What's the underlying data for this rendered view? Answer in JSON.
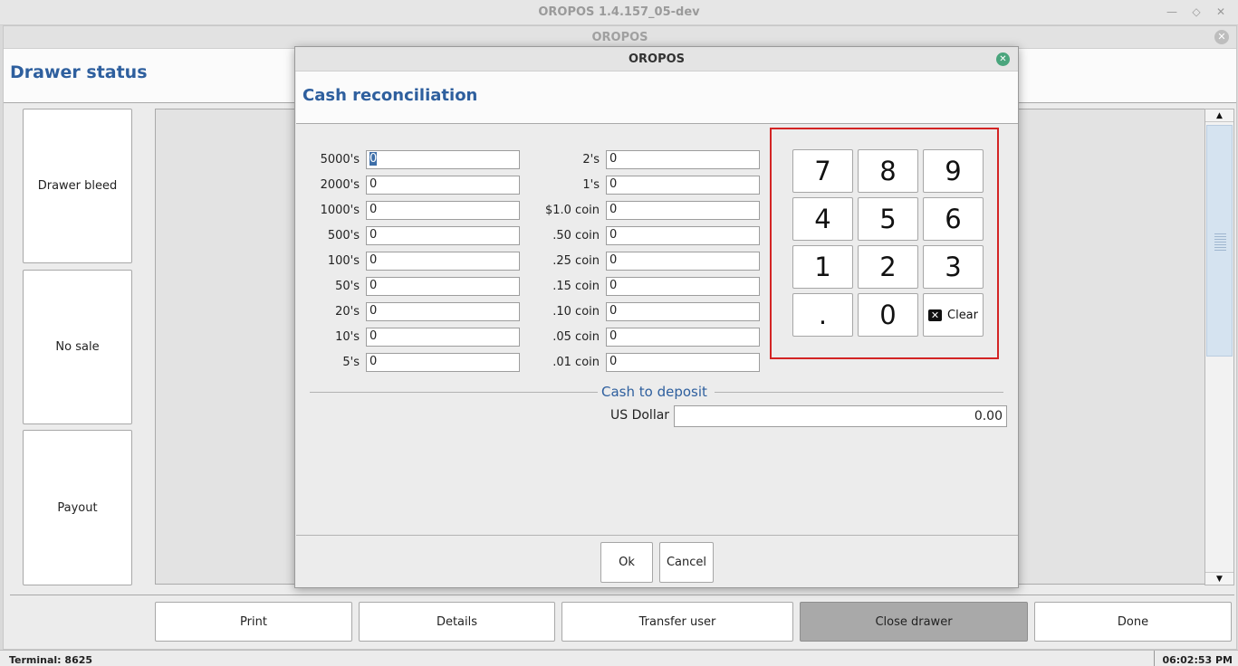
{
  "os_window": {
    "title": "OROPOS 1.4.157_05-dev"
  },
  "app_window": {
    "title": "OROPOS"
  },
  "page": {
    "title": "Drawer status"
  },
  "sidebar": {
    "buttons": [
      "Drawer bleed",
      "No sale",
      "Payout"
    ]
  },
  "bottom_bar": {
    "buttons": [
      "Print",
      "Details",
      "Transfer user",
      "Close drawer",
      "Done"
    ],
    "active": "Close drawer",
    "active_color": "#a9a9a9"
  },
  "status_bar": {
    "terminal": "Terminal: 8625",
    "time": "06:02:53 PM"
  },
  "dialog": {
    "title": "OROPOS",
    "heading": "Cash reconciliation",
    "bills": [
      {
        "label": "5000's",
        "value": "0"
      },
      {
        "label": "2000's",
        "value": "0"
      },
      {
        "label": "1000's",
        "value": "0"
      },
      {
        "label": "500's",
        "value": "0"
      },
      {
        "label": "100's",
        "value": "0"
      },
      {
        "label": "50's",
        "value": "0"
      },
      {
        "label": "20's",
        "value": "0"
      },
      {
        "label": "10's",
        "value": "0"
      },
      {
        "label": "5's",
        "value": "0"
      }
    ],
    "coins": [
      {
        "label": "2's",
        "value": "0"
      },
      {
        "label": "1's",
        "value": "0"
      },
      {
        "label": "$1.0 coin",
        "value": "0"
      },
      {
        "label": ".50 coin",
        "value": "0"
      },
      {
        "label": ".25 coin",
        "value": "0"
      },
      {
        "label": ".15 coin",
        "value": "0"
      },
      {
        "label": ".10 coin",
        "value": "0"
      },
      {
        "label": ".05 coin",
        "value": "0"
      },
      {
        "label": ".01 coin",
        "value": "0"
      }
    ],
    "numpad": {
      "keys": [
        "7",
        "8",
        "9",
        "4",
        "5",
        "6",
        "1",
        "2",
        "3",
        ".",
        "0"
      ],
      "clear_label": "Clear",
      "clear_icon": "clear-x-icon",
      "highlight_color": "#d32424"
    },
    "deposit": {
      "title": "Cash to deposit",
      "currency": "US Dollar",
      "amount": "0.00"
    },
    "ok_label": "Ok",
    "cancel_label": "Cancel"
  },
  "colors": {
    "heading": "#2e5f9e",
    "dialog_close": "#4aa57d"
  }
}
